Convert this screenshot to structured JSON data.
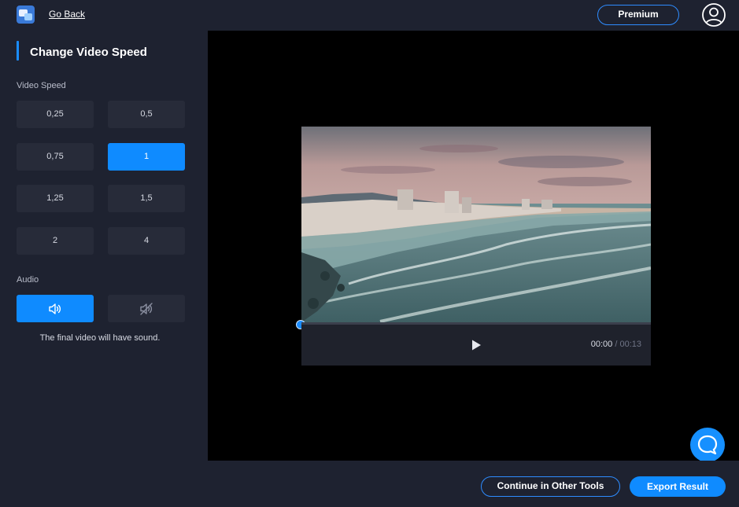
{
  "header": {
    "app_icon": "app-logo-icon",
    "go_back_label": "Go Back",
    "premium_label": "Premium",
    "account_icon": "user-circle-icon"
  },
  "sidebar": {
    "title": "Change Video Speed",
    "speed_label": "Video Speed",
    "speeds": [
      "0,25",
      "0,5",
      "0,75",
      "1",
      "1,25",
      "1,5",
      "2",
      "4"
    ],
    "selected_speed": "1",
    "audio_label": "Audio",
    "audio_options": [
      {
        "icon": "speaker-on-icon",
        "selected": true
      },
      {
        "icon": "speaker-muted-icon",
        "selected": false
      }
    ],
    "audio_note": "The final video will have sound."
  },
  "player": {
    "preview": "coastal-city-beach-at-dusk",
    "progress": 0,
    "current_time": "00:00",
    "separator": "/",
    "total_time": "00:13",
    "play_icon": "play-icon"
  },
  "footer": {
    "continue_label": "Continue in Other Tools",
    "export_label": "Export Result",
    "help_icon": "chat-bubble-icon"
  },
  "colors": {
    "accent": "#0f8bff",
    "panel": "#1e2230",
    "button": "#272b39"
  }
}
